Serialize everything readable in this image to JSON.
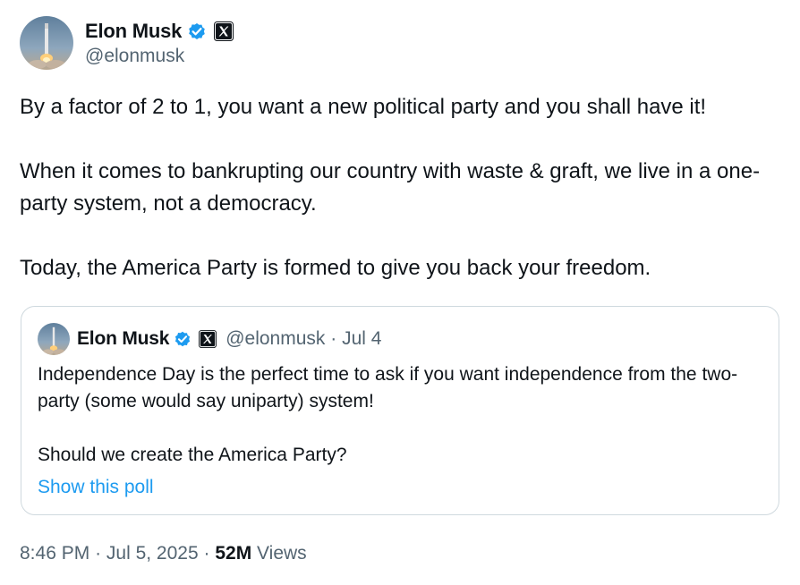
{
  "author": {
    "name": "Elon Musk",
    "handle": "@elonmusk",
    "avatar_icon": "rocket-launch-avatar",
    "verified_icon": "verified-badge-icon",
    "affiliate_icon": "x-logo-icon"
  },
  "tweet": {
    "paragraphs": [
      "By a factor of 2 to 1, you want a new political party and you shall have it!",
      "When it comes to bankrupting our country with waste & graft, we live in a one-party system, not a democracy.",
      "Today, the America Party is formed to give you back your freedom."
    ]
  },
  "quoted": {
    "name": "Elon Musk",
    "handle": "@elonmusk",
    "dot": "·",
    "date": "Jul 4",
    "paragraphs": [
      "Independence Day is the perfect time to ask if you want independence from the two-party (some would say uniparty) system!",
      "Should we create the America Party?"
    ],
    "poll_link": "Show this poll"
  },
  "footer": {
    "time": "8:46 PM",
    "dot1": "·",
    "date": "Jul 5, 2025",
    "dot2": "·",
    "views_count": "52M",
    "views_label": "Views"
  },
  "colors": {
    "text": "#0f1419",
    "secondary": "#536471",
    "link": "#1d9bf0",
    "border": "#cfd9de",
    "verified": "#1d9bf0"
  }
}
